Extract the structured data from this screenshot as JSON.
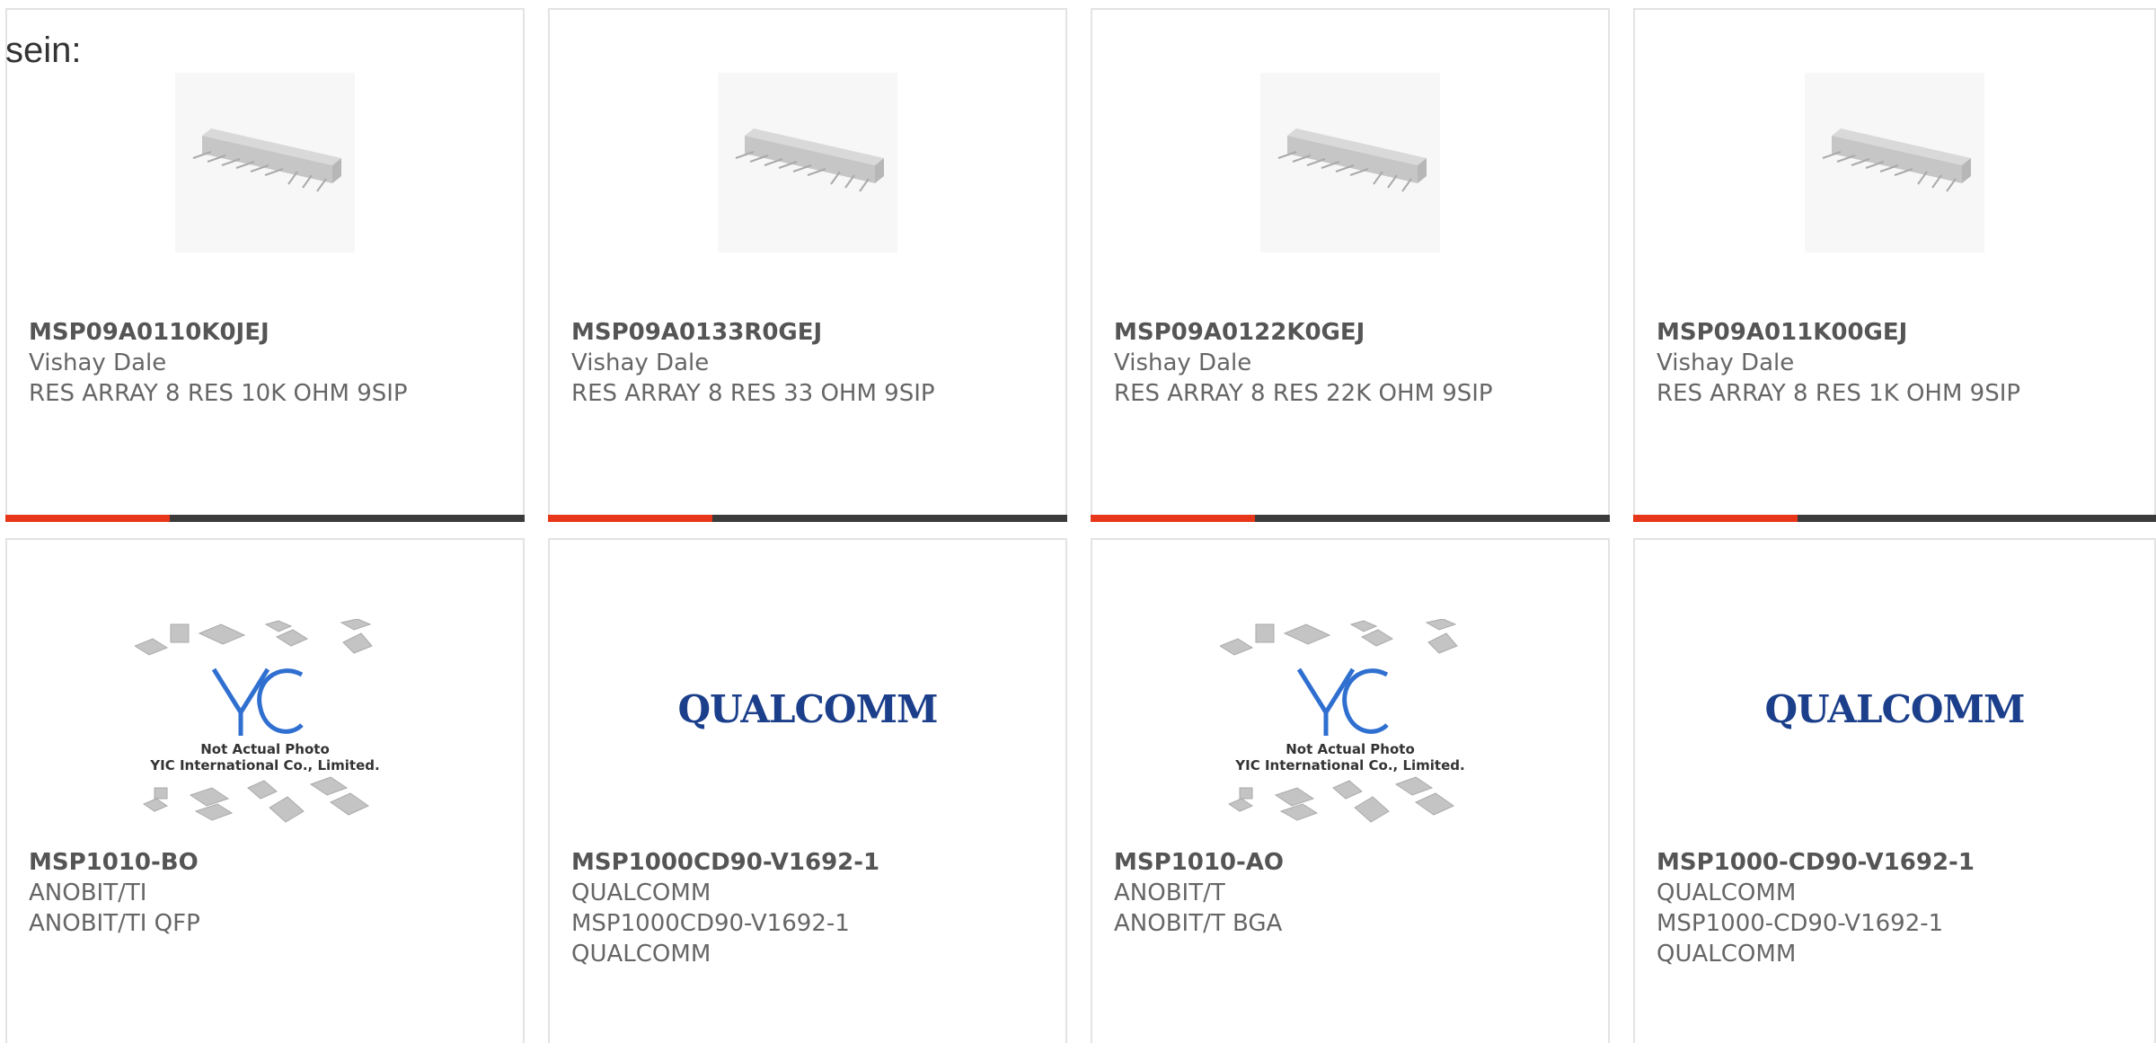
{
  "intro": {
    "text": "sein:"
  },
  "products": [
    {
      "part_number": "MSP09A0110K0JEJ",
      "manufacturer": "Vishay Dale",
      "description_lines": [
        "RES ARRAY 8 RES 10K OHM 9SIP"
      ],
      "image": "resistor-array-photo"
    },
    {
      "part_number": "MSP09A0133R0GEJ",
      "manufacturer": "Vishay Dale",
      "description_lines": [
        "RES ARRAY 8 RES 33 OHM 9SIP"
      ],
      "image": "resistor-array-photo"
    },
    {
      "part_number": "MSP09A0122K0GEJ",
      "manufacturer": "Vishay Dale",
      "description_lines": [
        "RES ARRAY 8 RES 22K OHM 9SIP"
      ],
      "image": "resistor-array-photo"
    },
    {
      "part_number": "MSP09A011K00GEJ",
      "manufacturer": "Vishay Dale",
      "description_lines": [
        "RES ARRAY 8 RES 1K OHM 9SIP"
      ],
      "image": "resistor-array-photo"
    },
    {
      "part_number": "MSP1010-BO",
      "manufacturer": "ANOBIT/TI",
      "description_lines": [
        "ANOBIT/TI QFP"
      ],
      "image": "yic-not-actual-photo",
      "image_caption_1": "Not Actual Photo",
      "image_caption_2": "YIC International Co., Limited."
    },
    {
      "part_number": "MSP1000CD90-V1692-1",
      "manufacturer": "QUALCOMM",
      "description_lines": [
        "MSP1000CD90-V1692-1",
        "QUALCOMM"
      ],
      "image": "qualcomm-logo",
      "logo_text": "QUALCOMM"
    },
    {
      "part_number": "MSP1010-AO",
      "manufacturer": "ANOBIT/T",
      "description_lines": [
        "ANOBIT/T BGA"
      ],
      "image": "yic-not-actual-photo",
      "image_caption_1": "Not Actual Photo",
      "image_caption_2": "YIC International Co., Limited."
    },
    {
      "part_number": "MSP1000-CD90-V1692-1",
      "manufacturer": "QUALCOMM",
      "description_lines": [
        "MSP1000-CD90-V1692-1",
        "QUALCOMM"
      ],
      "image": "qualcomm-logo",
      "logo_text": "QUALCOMM"
    }
  ],
  "colors": {
    "accent": "#e8361a",
    "bar": "#3b3b3b",
    "qualcomm_blue": "#1b3f8b",
    "yic_blue": "#2f6fd0"
  }
}
